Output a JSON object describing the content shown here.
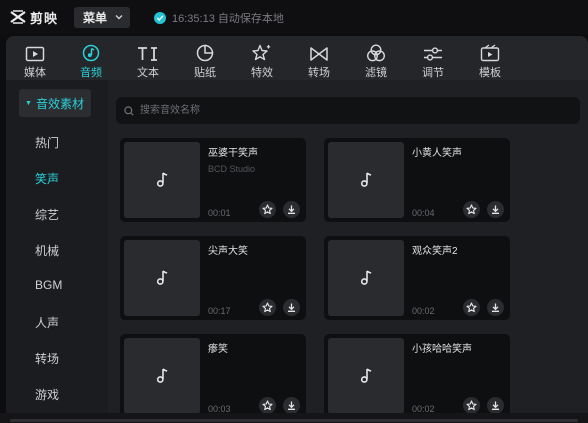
{
  "app": {
    "name": "剪映",
    "menu_label": "菜单",
    "save_status": "16:35:13 自动保存本地"
  },
  "toolbar": {
    "tabs": [
      {
        "label": "媒体",
        "icon": "media-icon"
      },
      {
        "label": "音频",
        "icon": "audio-icon"
      },
      {
        "label": "文本",
        "icon": "text-icon"
      },
      {
        "label": "贴纸",
        "icon": "sticker-icon"
      },
      {
        "label": "特效",
        "icon": "effects-icon"
      },
      {
        "label": "转场",
        "icon": "transition-icon"
      },
      {
        "label": "滤镜",
        "icon": "filter-icon"
      },
      {
        "label": "调节",
        "icon": "adjust-icon"
      },
      {
        "label": "模板",
        "icon": "template-icon"
      }
    ],
    "active": "音频"
  },
  "sidebar": {
    "header": "音效素材",
    "items": [
      "热门",
      "笑声",
      "综艺",
      "机械",
      "BGM",
      "人声",
      "转场",
      "游戏"
    ],
    "active": "笑声"
  },
  "search": {
    "placeholder": "搜索音效名称"
  },
  "sounds": [
    {
      "name": "巫婆干笑声",
      "artist": "BCD Studio",
      "duration": "00:01"
    },
    {
      "name": "小黄人笑声",
      "artist": "",
      "duration": "00:04"
    },
    {
      "name": "尖声大笑",
      "artist": "",
      "duration": "00:17"
    },
    {
      "name": "观众笑声2",
      "artist": "",
      "duration": "00:02"
    },
    {
      "name": "瘆笑",
      "artist": "",
      "duration": "00:03"
    },
    {
      "name": "小孩哈哈笑声",
      "artist": "",
      "duration": "00:02"
    }
  ],
  "colors": {
    "accent": "#2ad0d8",
    "background": "#0d0d0f",
    "panel": "#1b1c1f"
  }
}
